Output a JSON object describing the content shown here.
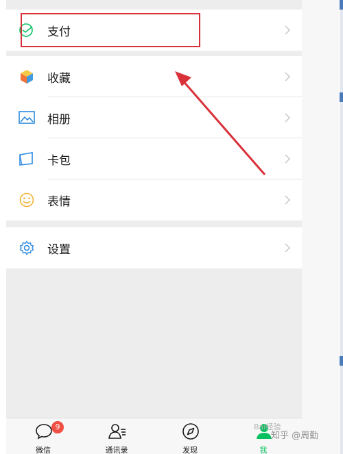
{
  "menu": {
    "pay": {
      "label": "支付"
    },
    "items": [
      {
        "label": "收藏"
      },
      {
        "label": "相册"
      },
      {
        "label": "卡包"
      },
      {
        "label": "表情"
      }
    ],
    "settings": {
      "label": "设置"
    }
  },
  "tabbar": {
    "chats": {
      "label": "微信",
      "badge": "9"
    },
    "contacts": {
      "label": "通讯录"
    },
    "discover": {
      "label": "发现"
    },
    "me": {
      "label": "我"
    }
  },
  "watermark": {
    "text": "知乎 @周勤",
    "secondary": "Bai经验"
  },
  "colors": {
    "highlight_box": "#d9313a",
    "active_tab": "#07c160",
    "badge": "#f04f43",
    "background": "#ededed"
  },
  "icons": {
    "pay": "wechat-pay-icon",
    "favorites": "cube-icon",
    "album": "picture-icon",
    "cards": "card-icon",
    "stickers": "smiley-icon",
    "settings": "gear-icon"
  }
}
